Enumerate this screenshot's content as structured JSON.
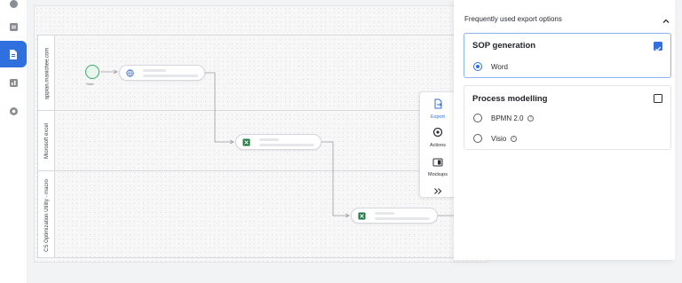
{
  "canvas": {
    "lanes": [
      {
        "label": "appian.manichee.com"
      },
      {
        "label": "Microsoft excel"
      },
      {
        "label": "CS Optimization Utility - macro"
      }
    ],
    "start_label": "Start"
  },
  "toolbar": {
    "items": [
      {
        "label": "Export",
        "icon": "file-export-icon"
      },
      {
        "label": "Actions",
        "icon": "actions-icon"
      },
      {
        "label": "Mockups",
        "icon": "mockups-icon"
      },
      {
        "label": "",
        "icon": "expand-chevron-icon"
      }
    ]
  },
  "panel": {
    "header": "Frequently used export options",
    "sop": {
      "title": "SOP generation",
      "checked": true,
      "options": [
        {
          "label": "Word",
          "selected": true
        }
      ]
    },
    "process": {
      "title": "Process modelling",
      "checked": false,
      "options": [
        {
          "label": "BPMN 2.0",
          "selected": false
        },
        {
          "label": "Visio",
          "selected": false
        }
      ]
    }
  },
  "colors": {
    "accent": "#2f6fde",
    "start": "#3aa86b",
    "excel": "#1f7a43"
  }
}
